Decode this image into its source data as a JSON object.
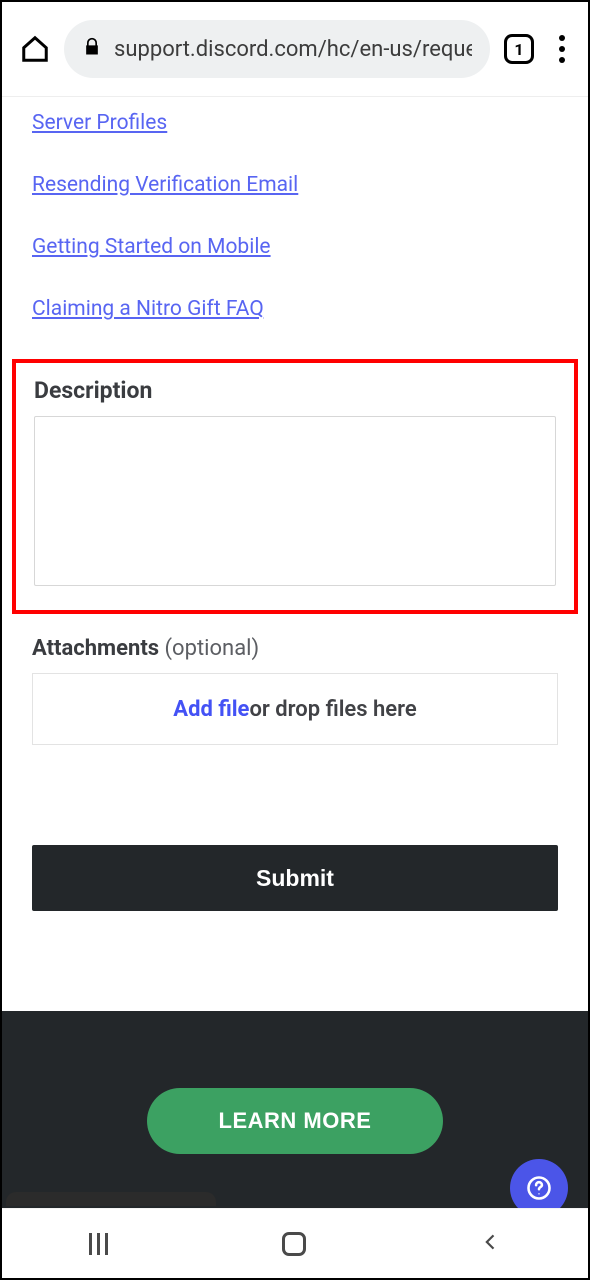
{
  "browser": {
    "url": "support.discord.com/hc/en-us/reques",
    "tab_count": "1"
  },
  "links": [
    "Server Profiles",
    "Resending Verification Email",
    "Getting Started on Mobile",
    "Claiming a Nitro Gift FAQ"
  ],
  "description": {
    "label": "Description",
    "value": ""
  },
  "attachments": {
    "label": "Attachments",
    "optional": "(optional)",
    "add_file": "Add file",
    "drop_text": " or drop files here"
  },
  "submit_label": "Submit",
  "learn_more_label": "LEARN MORE"
}
